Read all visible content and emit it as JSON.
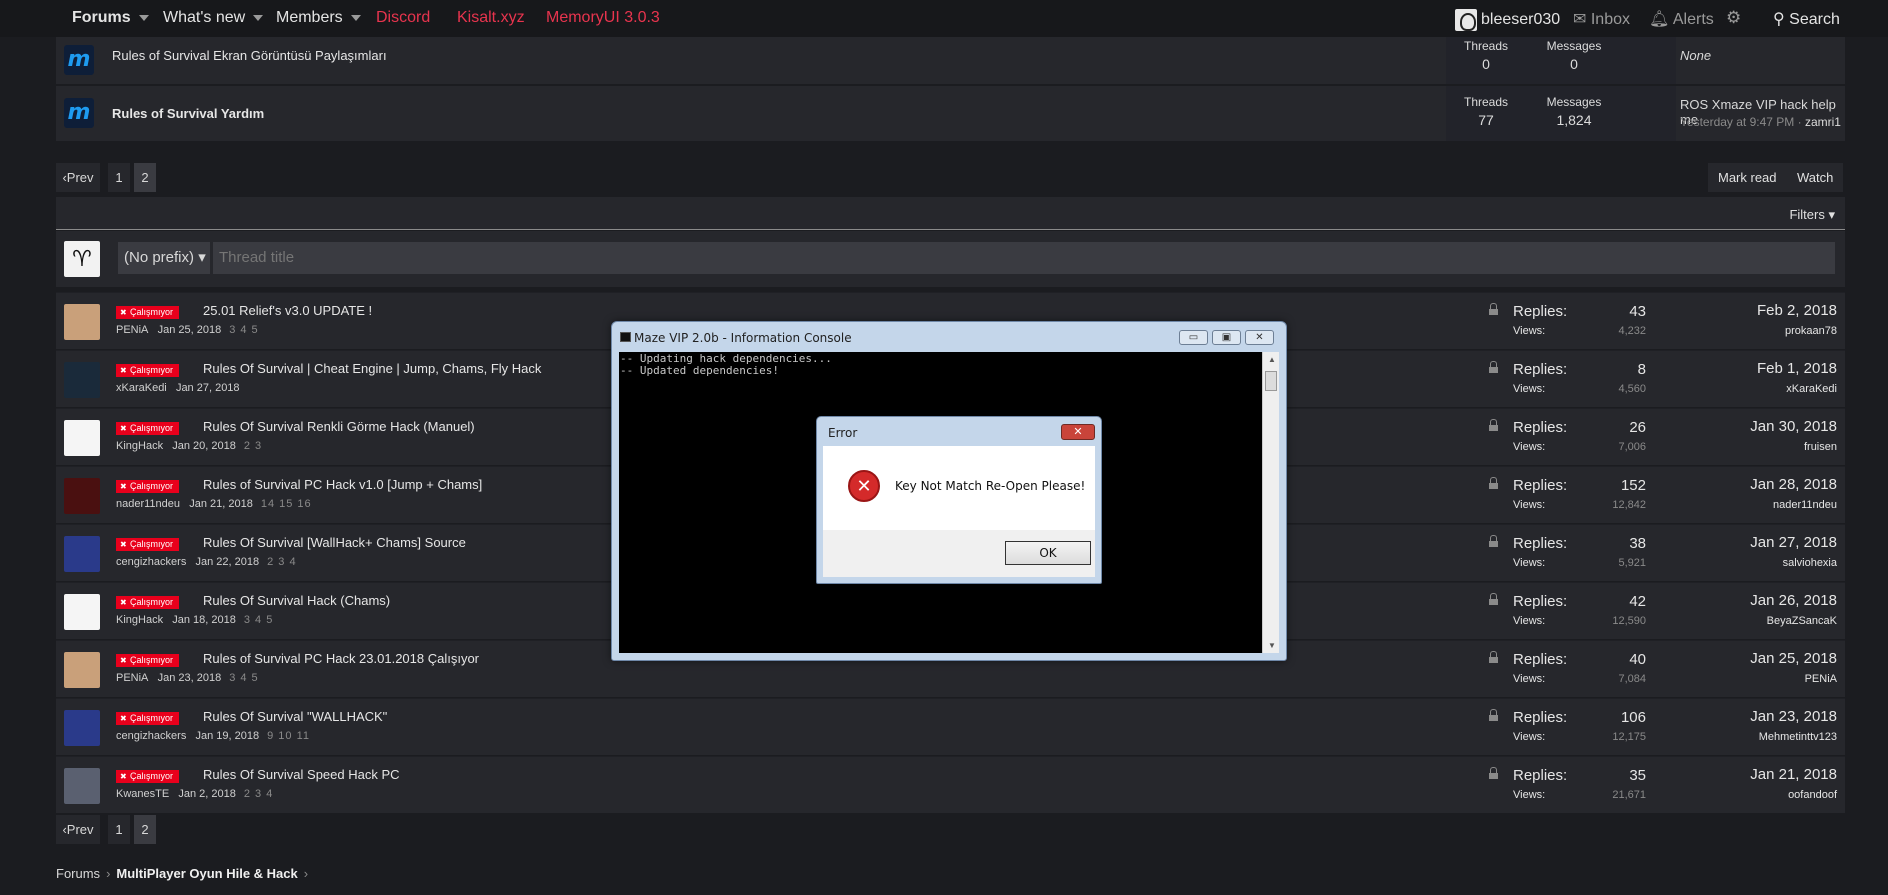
{
  "nav": {
    "forums": "Forums",
    "whats_new": "What's new",
    "members": "Members",
    "discord": "Discord",
    "kisalt": "Kisalt.xyz",
    "memoryui": "MemoryUI 3.0.3",
    "username": "bleeser030",
    "inbox": "Inbox",
    "alerts": "Alerts",
    "search": "Search"
  },
  "nodes": [
    {
      "title": "Rules of Survival Ekran Görüntüsü Paylaşımları",
      "threads_label": "Threads",
      "threads": "0",
      "messages_label": "Messages",
      "messages": "0",
      "last": "None",
      "last_meta": ""
    },
    {
      "title": "Rules of Survival Yardım",
      "threads_label": "Threads",
      "threads": "77",
      "messages_label": "Messages",
      "messages": "1,824",
      "last": "ROS Xmaze VIP hack help me",
      "last_meta": "Yesterday at 9:47 PM · ",
      "last_user": "zamri1"
    }
  ],
  "pager": {
    "prev": "Prev",
    "p1": "1",
    "p2": "2"
  },
  "actions": {
    "mark_read": "Mark read",
    "watch": "Watch",
    "filters": "Filters"
  },
  "quick": {
    "prefix": "(No prefix)",
    "title_placeholder": "Thread title"
  },
  "badge_label": "Çalışmıyor",
  "replies_label": "Replies:",
  "views_label": "Views:",
  "threads": [
    {
      "title": "25.01 Relief's v3.0 UPDATE !",
      "author": "PENiA",
      "date": "Jan 25, 2018",
      "pages": "3  4  5",
      "replies": "43",
      "views": "4,232",
      "last_date": "Feb 2, 2018",
      "last_user": "prokaan78"
    },
    {
      "title": "Rules Of Survival | Cheat Engine | Jump, Chams, Fly Hack",
      "author": "xKaraKedi",
      "date": "Jan 27, 2018",
      "pages": "",
      "replies": "8",
      "views": "4,560",
      "last_date": "Feb 1, 2018",
      "last_user": "xKaraKedi"
    },
    {
      "title": "Rules Of Survival Renkli Görme Hack (Manuel)",
      "author": "KingHack",
      "date": "Jan 20, 2018",
      "pages": "2  3",
      "replies": "26",
      "views": "7,006",
      "last_date": "Jan 30, 2018",
      "last_user": "fruisen"
    },
    {
      "title": "Rules of Survival PC Hack v1.0 [Jump + Chams]",
      "author": "nader11ndeu",
      "date": "Jan 21, 2018",
      "pages": "14  15  16",
      "replies": "152",
      "views": "12,842",
      "last_date": "Jan 28, 2018",
      "last_user": "nader11ndeu"
    },
    {
      "title": "Rules Of Survival [WallHack+ Chams] Source",
      "author": "cengizhackers",
      "date": "Jan 22, 2018",
      "pages": "2  3  4",
      "replies": "38",
      "views": "5,921",
      "last_date": "Jan 27, 2018",
      "last_user": "salviohexia"
    },
    {
      "title": "Rules Of Survival Hack (Chams)",
      "author": "KingHack",
      "date": "Jan 18, 2018",
      "pages": "3  4  5",
      "replies": "42",
      "views": "12,590",
      "last_date": "Jan 26, 2018",
      "last_user": "BeyaZSancaK"
    },
    {
      "title": "Rules of Survival PC Hack 23.01.2018 Çalışıyor",
      "author": "PENiA",
      "date": "Jan 23, 2018",
      "pages": "3  4  5",
      "replies": "40",
      "views": "7,084",
      "last_date": "Jan 25, 2018",
      "last_user": "PENiA"
    },
    {
      "title": "Rules Of Survival \"WALLHACK\"",
      "author": "cengizhackers",
      "date": "Jan 19, 2018",
      "pages": "9  10  11",
      "replies": "106",
      "views": "12,175",
      "last_date": "Jan 23, 2018",
      "last_user": "Mehmetinttv123"
    },
    {
      "title": "Rules Of Survival Speed Hack PC",
      "author": "KwanesTE",
      "date": "Jan 2, 2018",
      "pages": "2  3  4",
      "replies": "35",
      "views": "21,671",
      "last_date": "Jan 21, 2018",
      "last_user": "oofandoof"
    }
  ],
  "breadcrumb": {
    "forums": "Forums",
    "section": "MultiPlayer Oyun Hile & Hack"
  },
  "console": {
    "title": "Maze VIP 2.0b - Information Console",
    "lines": "-- Updating hack dependencies...\n-- Updated dependencies!"
  },
  "error": {
    "title": "Error",
    "message": "Key Not Match Re-Open Please!",
    "ok": "OK"
  },
  "colors": {
    "badge": "#e8001c",
    "nav_red": "#e8344e",
    "node_icon": "#1e9bf0"
  }
}
